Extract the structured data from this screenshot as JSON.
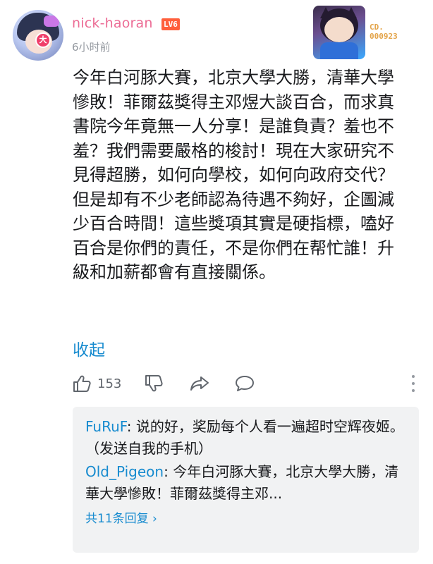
{
  "comment": {
    "user": {
      "name": "nick-haoran",
      "level": "LV6",
      "avatar_badge": "大"
    },
    "time": "6小时前",
    "fan_card": {
      "number": "CD. 000923"
    },
    "content": "今年白河豚大賽，北京大學大勝，清華大學慘敗！菲爾茲獎得主邓煜大談百合，而求真書院今年竟無一人分享！是誰負責？羞也不羞？我們需要嚴格的梭討！現在大家研究不見得超勝，如何向學校，如何向政府交代？但是却有不少老師認為待遇不夠好，企圖減少百合時間！這些獎項其實是硬指標，嗑好百合是你們的責任，不是你們在帮忙誰！升級和加薪都會有直接關係。",
    "collapse_label": "收起",
    "actions": {
      "like_icon": "thumbs-up-icon",
      "like_count": "153",
      "dislike_icon": "thumbs-down-icon",
      "share_icon": "share-icon",
      "reply_icon": "comment-bubble-icon",
      "more_icon": "more-vertical-icon"
    },
    "replies": {
      "items": [
        {
          "user": "FuRuF",
          "separator": ": ",
          "text": "说的好，奖励每个人看一遍超时空辉夜姬。（发送自我的手机）"
        },
        {
          "user": "Old_Pigeon",
          "separator": ": ",
          "text": "今年白河豚大賽，北京大學大勝，清華大學慘敗！菲爾茲獎得主邓..."
        }
      ],
      "total_label": "共11条回复 ›"
    }
  },
  "colors": {
    "username": "#ec6c95",
    "link": "#178bcf",
    "level_badge": "#ff5f3c",
    "muted": "#9499a0",
    "reply_bg": "#f1f2f3"
  }
}
